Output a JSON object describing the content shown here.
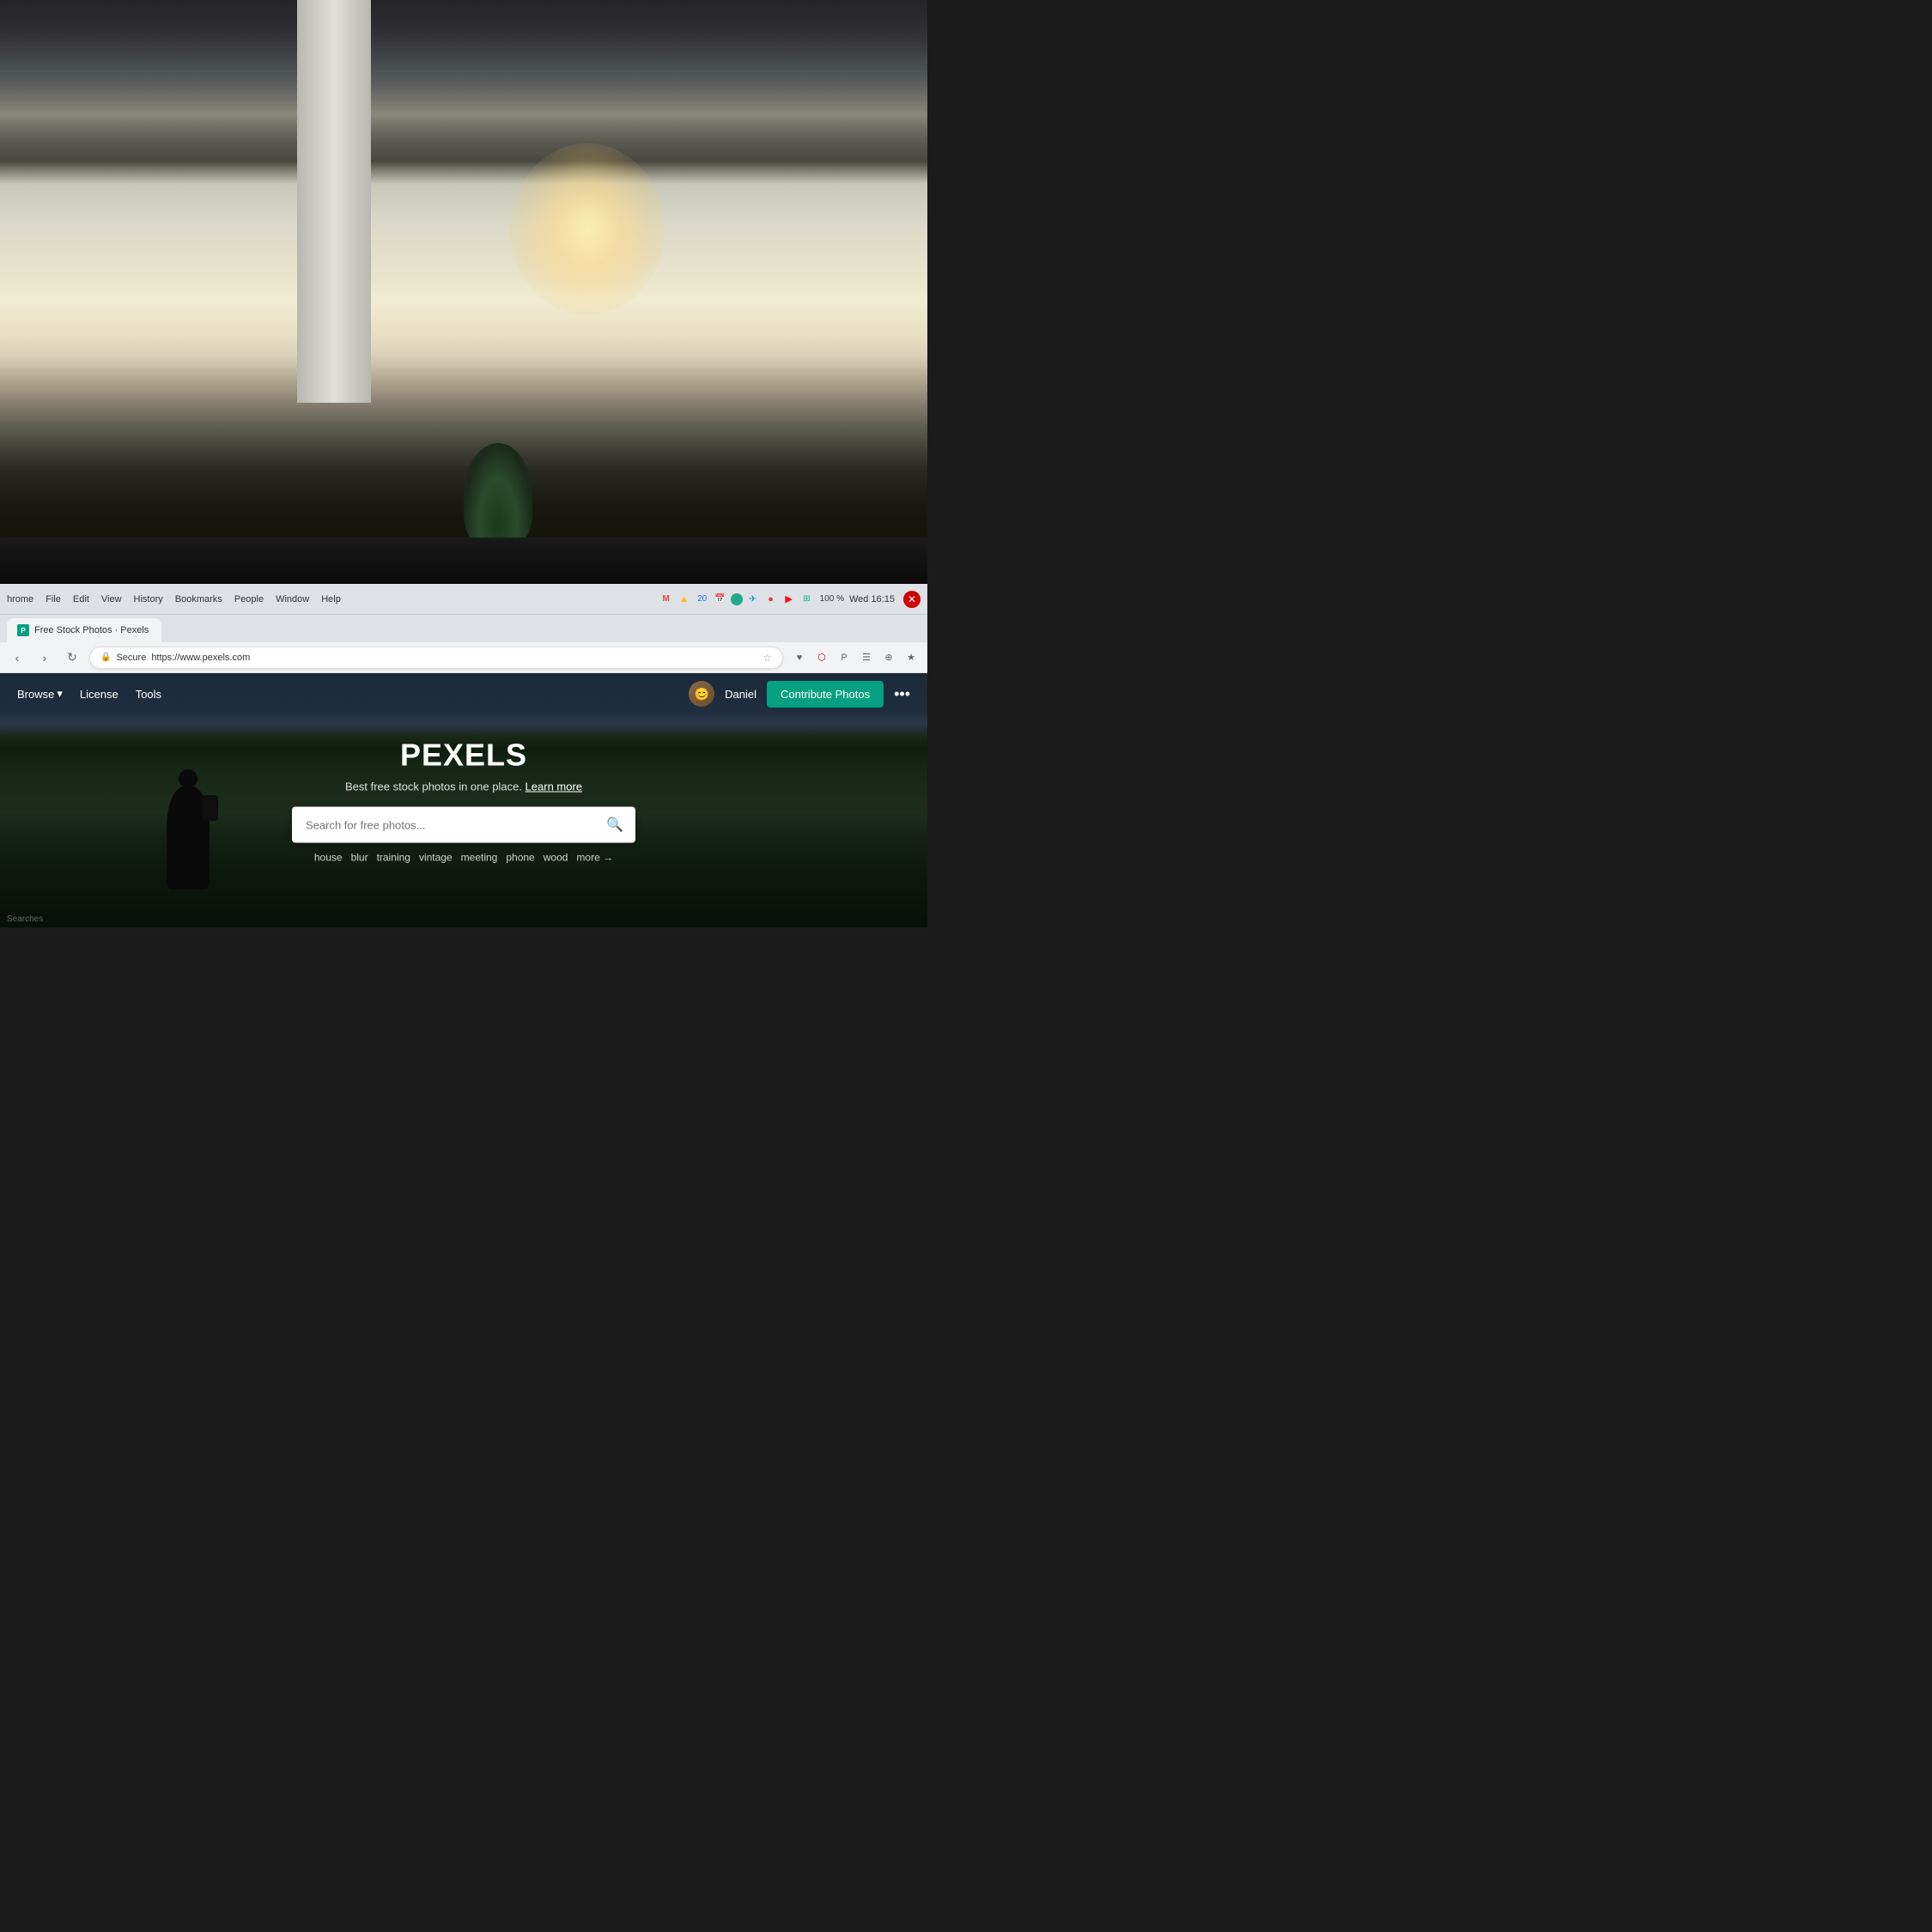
{
  "background": {
    "description": "Office interior with bright windows and bokeh light"
  },
  "browser": {
    "title": "Chrome",
    "menus": [
      "hrome",
      "File",
      "Edit",
      "View",
      "History",
      "Bookmarks",
      "People",
      "Window",
      "Help"
    ],
    "system_clock": "Wed 16:15",
    "battery_percent": "100 %",
    "tab": {
      "label": "Free Stock Photos · Pexels",
      "favicon_letter": "P"
    },
    "addressbar": {
      "secure_label": "Secure",
      "url": "https://www.pexels.com",
      "reload_icon": "↻",
      "back_icon": "‹",
      "forward_icon": "›"
    }
  },
  "pexels": {
    "nav": {
      "browse_label": "Browse",
      "license_label": "License",
      "tools_label": "Tools",
      "user_name": "Daniel",
      "contribute_button": "Contribute Photos",
      "more_icon": "•••"
    },
    "hero": {
      "logo": "PEXELS",
      "tagline": "Best free stock photos in one place.",
      "learn_more": "Learn more",
      "search_placeholder": "Search for free photos...",
      "search_icon": "🔍",
      "tags": [
        "house",
        "blur",
        "training",
        "vintage",
        "meeting",
        "phone",
        "wood",
        "more →"
      ]
    }
  },
  "footer": {
    "searches_label": "Searches"
  }
}
